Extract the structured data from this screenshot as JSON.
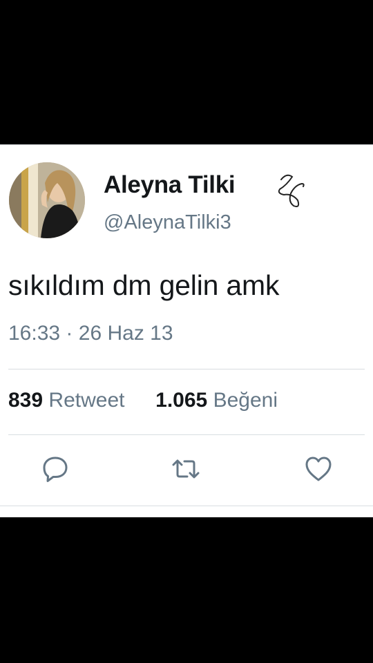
{
  "tweet": {
    "author": {
      "name": "Aleyna Tilki",
      "handle": "@AleynaTilki3",
      "avatar_icon": "profile-photo"
    },
    "text": "sıkıldım dm gelin amk",
    "time": "16:33",
    "separator": "·",
    "date": "26 Haz 13",
    "stats": {
      "retweet_count": "839",
      "retweet_label": "Retweet",
      "like_count": "1.065",
      "like_label": "Beğeni"
    },
    "actions": {
      "reply_icon": "reply-icon",
      "retweet_icon": "retweet-icon",
      "like_icon": "heart-icon"
    }
  },
  "colors": {
    "text_primary": "#14171a",
    "text_secondary": "#657786",
    "divider": "#d8dde1",
    "background": "#ffffff",
    "frame": "#000000"
  }
}
